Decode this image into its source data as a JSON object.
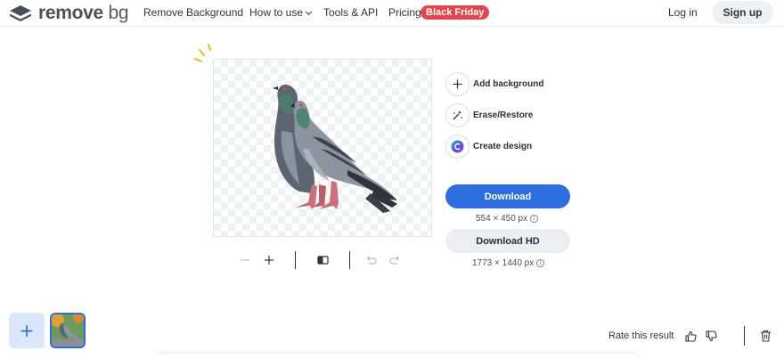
{
  "brand": {
    "name_main": "remove",
    "name_suffix": "bg",
    "icon": "layers-logo-icon"
  },
  "nav": {
    "items": [
      {
        "label": "Remove Background"
      },
      {
        "label": "How to use"
      },
      {
        "label": "Tools & API"
      },
      {
        "label": "Pricing"
      }
    ],
    "badge": "Black Friday",
    "login": "Log in",
    "signup": "Sign up"
  },
  "editor": {
    "preview_alt": "pigeons-cutout",
    "toolbar": {
      "icons": [
        "zoom-out-icon",
        "zoom-in-icon",
        "compare-icon",
        "undo-icon",
        "redo-icon"
      ]
    }
  },
  "actions": {
    "items": [
      {
        "label": "Add background",
        "icon": "plus-icon"
      },
      {
        "label": "Erase/Restore",
        "icon": "magic-wand-icon"
      },
      {
        "label": "Create design",
        "icon": "canva-icon"
      }
    ],
    "download_label": "Download",
    "download_size": "554 × 450 px",
    "download_hd_label": "Download HD",
    "download_hd_size": "1773 × 1440 px"
  },
  "footer": {
    "add_label": "+",
    "rate_label": "Rate this result"
  },
  "colors": {
    "primary": "#2d6de0",
    "badge": "#e2474f",
    "secondary_button": "#eceef1"
  }
}
